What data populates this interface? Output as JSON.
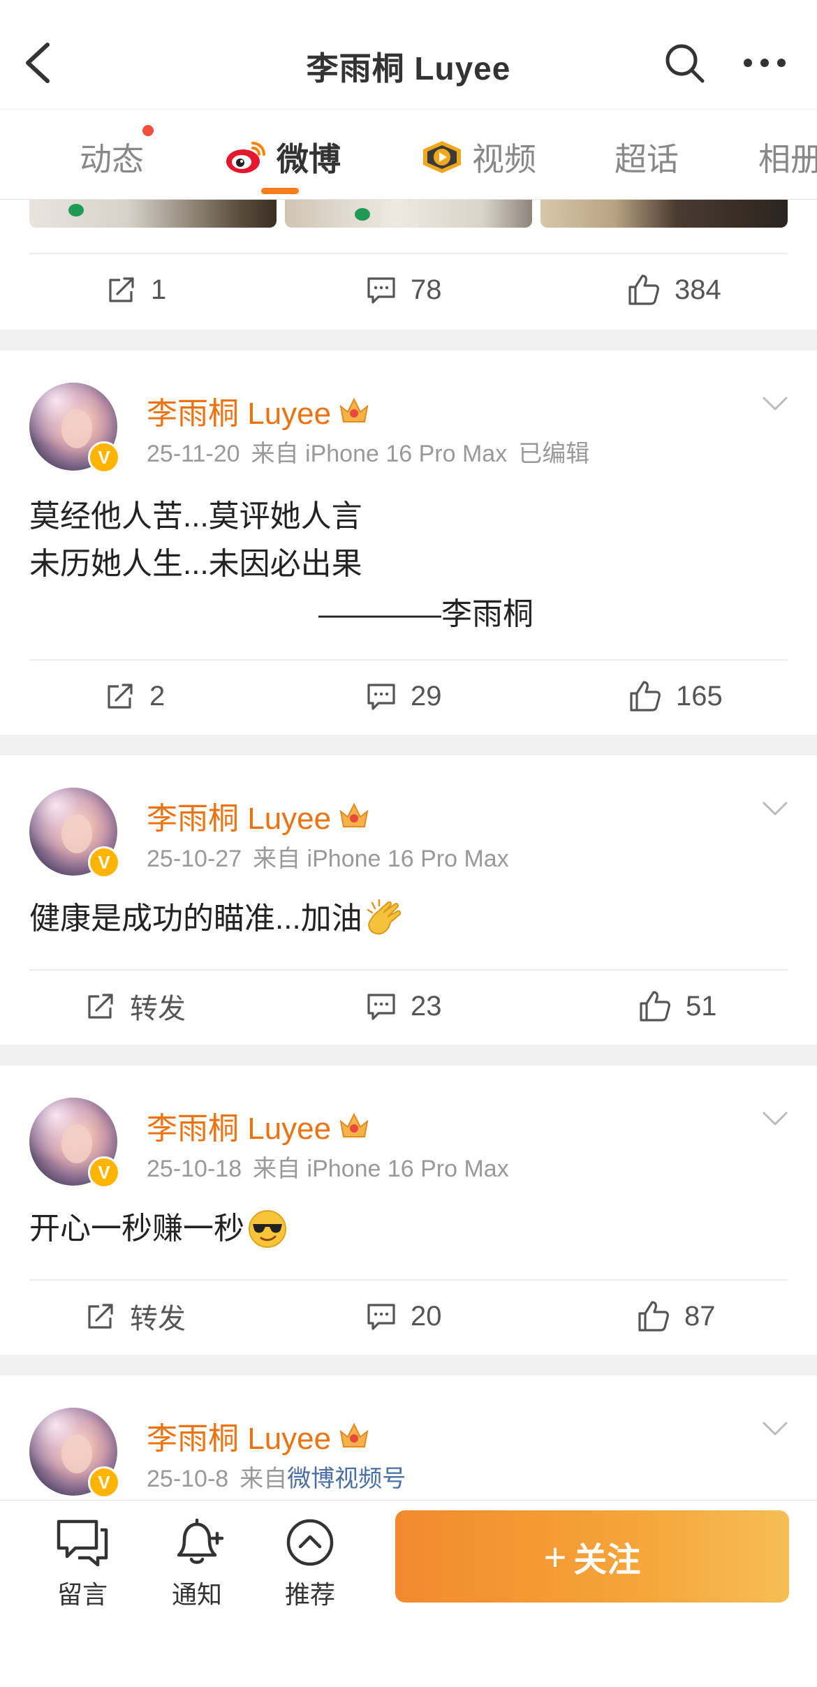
{
  "header": {
    "title": "李雨桐 Luyee",
    "back_icon": "chevron-left-icon",
    "search_icon": "search-icon",
    "more_icon": "more-icon"
  },
  "tabs": [
    {
      "label": "动态",
      "has_dot": true
    },
    {
      "label": "微博",
      "active": true,
      "icon": "weibo-logo-icon"
    },
    {
      "label": "视频",
      "icon": "video-channel-icon"
    },
    {
      "label": "超话"
    },
    {
      "label": "相册"
    }
  ],
  "first_post": {
    "repost": "1",
    "comments": "78",
    "likes": "384"
  },
  "posts": [
    {
      "author": "李雨桐 Luyee",
      "date": "25-11-20",
      "source": "来自 iPhone 16 Pro Max",
      "edited": "已编辑",
      "lines": [
        "莫经他人苦...莫评她人言",
        "未历她人生...未因必出果",
        "————李雨桐"
      ],
      "repost": "2",
      "comments": "29",
      "likes": "165"
    },
    {
      "author": "李雨桐 Luyee",
      "date": "25-10-27",
      "source": "来自 iPhone 16 Pro Max",
      "lines": [
        "健康是成功的瞄准...加油"
      ],
      "emoji": "clapping-hands-emoji",
      "repost": "转发",
      "comments": "23",
      "likes": "51"
    },
    {
      "author": "李雨桐 Luyee",
      "date": "25-10-18",
      "source": "来自 iPhone 16 Pro Max",
      "lines": [
        "开心一秒赚一秒"
      ],
      "emoji": "sunglasses-emoji",
      "repost": "转发",
      "comments": "20",
      "likes": "87"
    },
    {
      "author": "李雨桐 Luyee",
      "date": "25-10-8",
      "source_prefix": "来自",
      "source_link": "微博视频号"
    }
  ],
  "bottom_bar": {
    "message_label": "留言",
    "notify_label": "通知",
    "recommend_label": "推荐",
    "follow_label": "关注",
    "follow_plus": "+"
  },
  "colors": {
    "accent_orange": "#eb7311",
    "tab_underline": "#ff7d1e",
    "follow_gradient_start": "#f28a2d",
    "follow_gradient_end": "#f6be55",
    "verified_badge": "#ffb400",
    "link_blue": "#4a6fa5"
  }
}
